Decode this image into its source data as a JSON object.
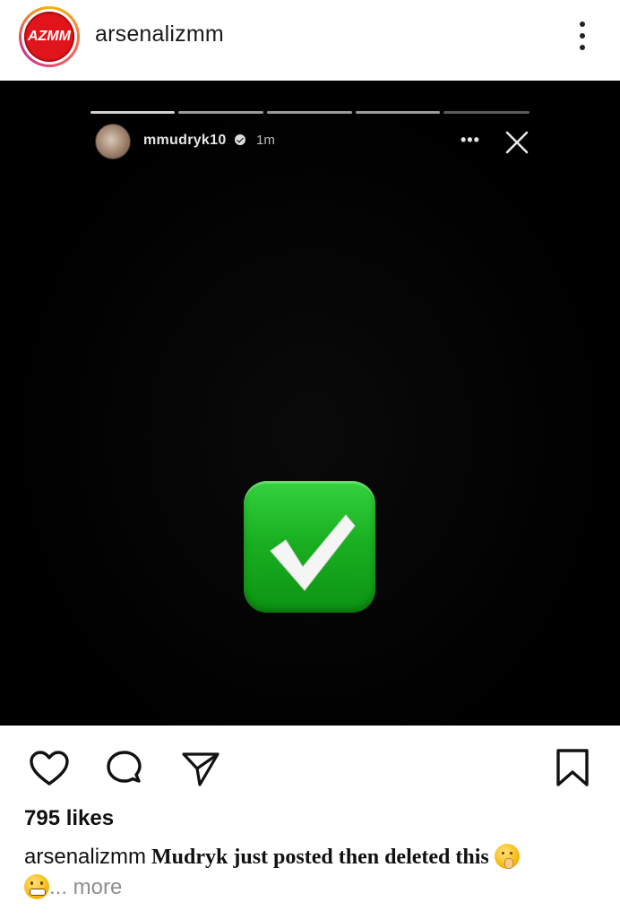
{
  "header": {
    "avatar_text": "AZMM",
    "username": "arsenalizmm",
    "menu_icon": "kebab-menu-icon"
  },
  "story": {
    "username": "mmudryk10",
    "time": "1m",
    "dots": "•••",
    "close_icon": "close-icon",
    "content_icon": "check-mark-button-emoji"
  },
  "actions": {
    "like_icon": "heart-icon",
    "comment_icon": "comment-icon",
    "share_icon": "send-icon",
    "save_icon": "bookmark-icon"
  },
  "post": {
    "likes": "795 likes",
    "caption_user": "arsenalizmm",
    "caption_text": " Mudryk just posted then deleted this ",
    "more": "... more"
  },
  "colors": {
    "brand_red": "#e0141b",
    "check_green": "#1ab022"
  }
}
